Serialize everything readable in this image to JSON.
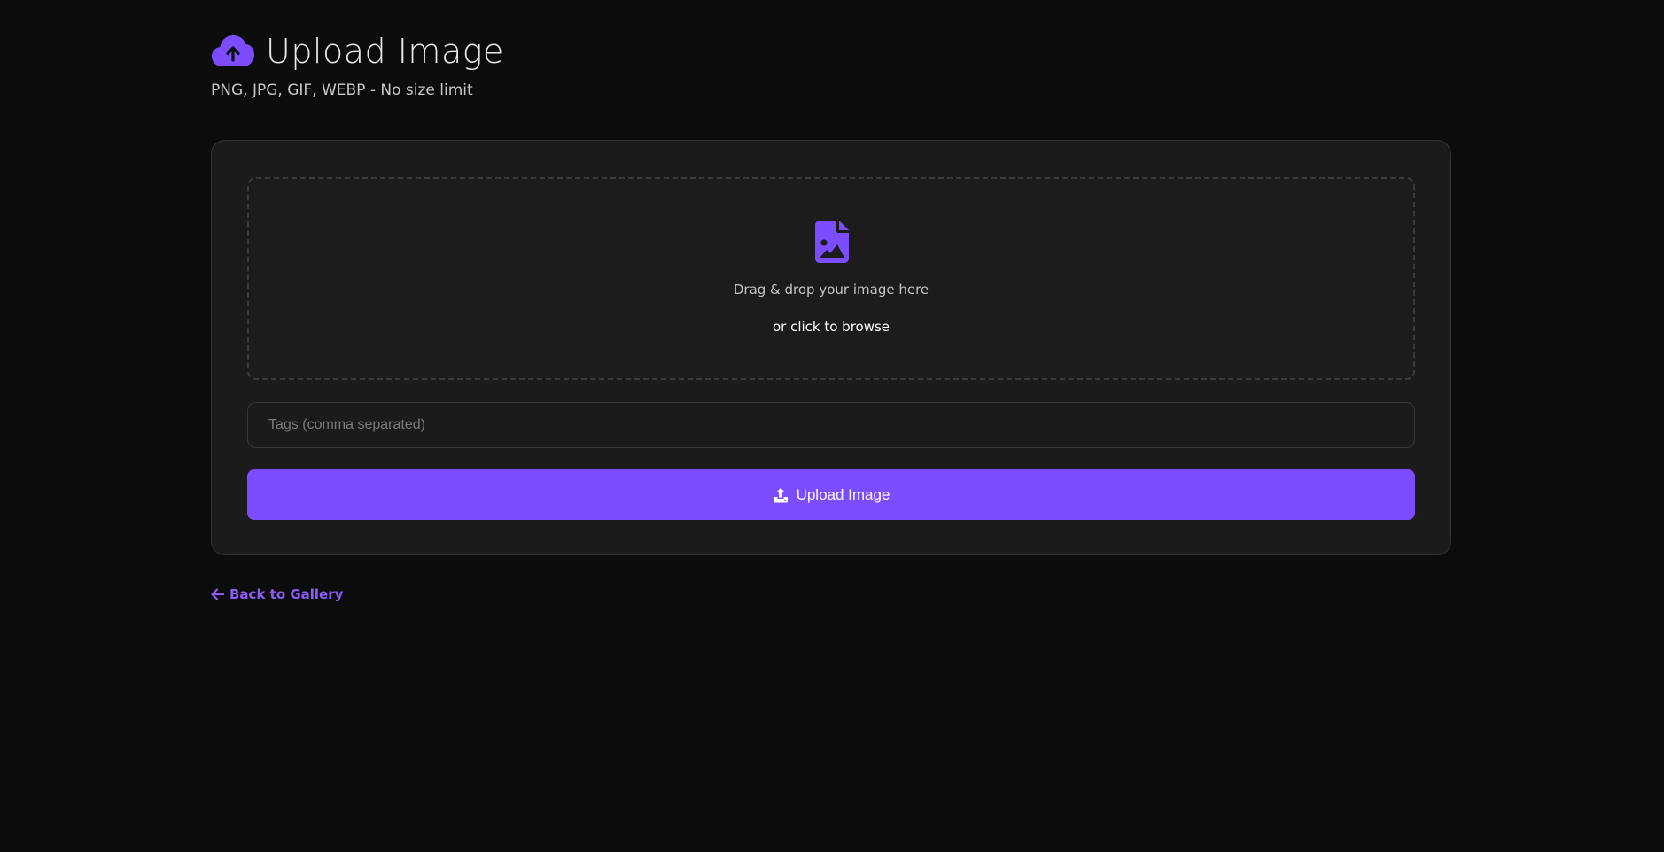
{
  "header": {
    "icon": "cloud-upload-icon",
    "title": "Upload Image",
    "subtitle": "PNG, JPG, GIF, WEBP - No size limit"
  },
  "dropzone": {
    "icon": "file-image-icon",
    "primary_text": "Drag & drop your image here",
    "secondary_text": "or click to browse"
  },
  "tags_input": {
    "placeholder": "Tags (comma separated)",
    "value": ""
  },
  "upload_button": {
    "icon": "upload-icon",
    "label": "Upload Image"
  },
  "back_link": {
    "icon": "arrow-left-icon",
    "label": "Back to Gallery"
  },
  "colors": {
    "accent": "#7c4dff",
    "link": "#8b5cf6",
    "background": "#0c0c0c",
    "card": "#1b1b1b"
  }
}
